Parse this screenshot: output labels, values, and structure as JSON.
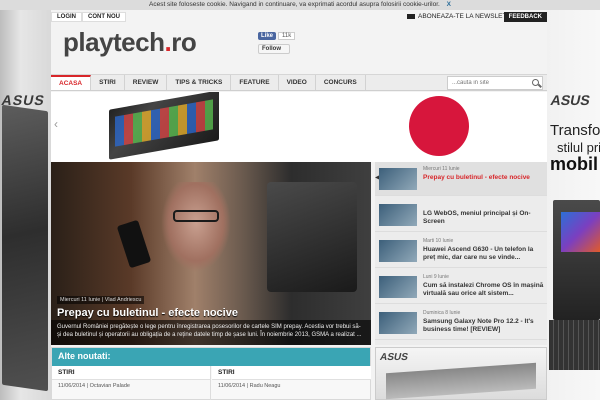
{
  "cookie_bar": {
    "text": "Acest site foloseste cookie. Navigand in continuare, va exprimati acordul asupra folosirii cookie-urilor.",
    "close": "X"
  },
  "top_links": {
    "login": "LOGIN",
    "account": "CONT NOU"
  },
  "newsletter": "ABONEAZA-TE LA NEWSLETTER",
  "feedback": "FEEDBACK",
  "logo": {
    "main": "playtech",
    "dot": ".",
    "tld": "ro"
  },
  "social": {
    "fb_like": "Like",
    "fb_count": "11k",
    "twitter_follow": "Follow"
  },
  "nav": [
    "ACASA",
    "STIRI",
    "REVIEW",
    "TIPS & TRICKS",
    "FEATURE",
    "VIDEO",
    "CONCURS"
  ],
  "search": {
    "placeholder": "...cauta in site"
  },
  "hero": {
    "meta": "Miercuri 11 Iunie | Vlad Andriescu",
    "title": "Prepay cu buletinul - efecte nocive",
    "desc": "Guvernul României pregătește o lege pentru înregistrarea posesorilor de cartele SIM prepay. Acestia vor trebui să-și dea buletinul și operatorii au obligația de a reține datele timp de șase luni. În noiembrie 2013, GSMA a realizat ..."
  },
  "side_items": [
    {
      "date": "Miercuri 11 Iunie",
      "title": "Prepay cu buletinul - efecte nocive"
    },
    {
      "date": "",
      "title": "LG WebOS, meniul principal și On-Screen"
    },
    {
      "date": "Marti 10 Iunie",
      "title": "Huawei Ascend G630 - Un telefon la preț mic, dar care nu se vinde..."
    },
    {
      "date": "Luni 9 Iunie",
      "title": "Cum să instalezi Chrome OS în mașină virtuală sau orice alt sistem..."
    },
    {
      "date": "Duminica 8 Iunie",
      "title": "Samsung Galaxy Note Pro 12.2 - It's business time! [REVIEW]"
    }
  ],
  "alte": {
    "header": "Alte noutati:",
    "cols": [
      {
        "cat": "STIRI",
        "meta": "11/06/2014 | Octavian Palade"
      },
      {
        "cat": "STIRI",
        "meta": "11/06/2014 | Radu Neagu"
      }
    ]
  },
  "ads": {
    "left_brand": "ASUS",
    "right_brand": "ASUS",
    "right_line1": "Transform",
    "right_line2": "stilul prin",
    "right_line3": "mobil",
    "box_brand": "ASUS"
  },
  "colors": {
    "accent": "#d8262a",
    "teal": "#3aa5b4"
  }
}
